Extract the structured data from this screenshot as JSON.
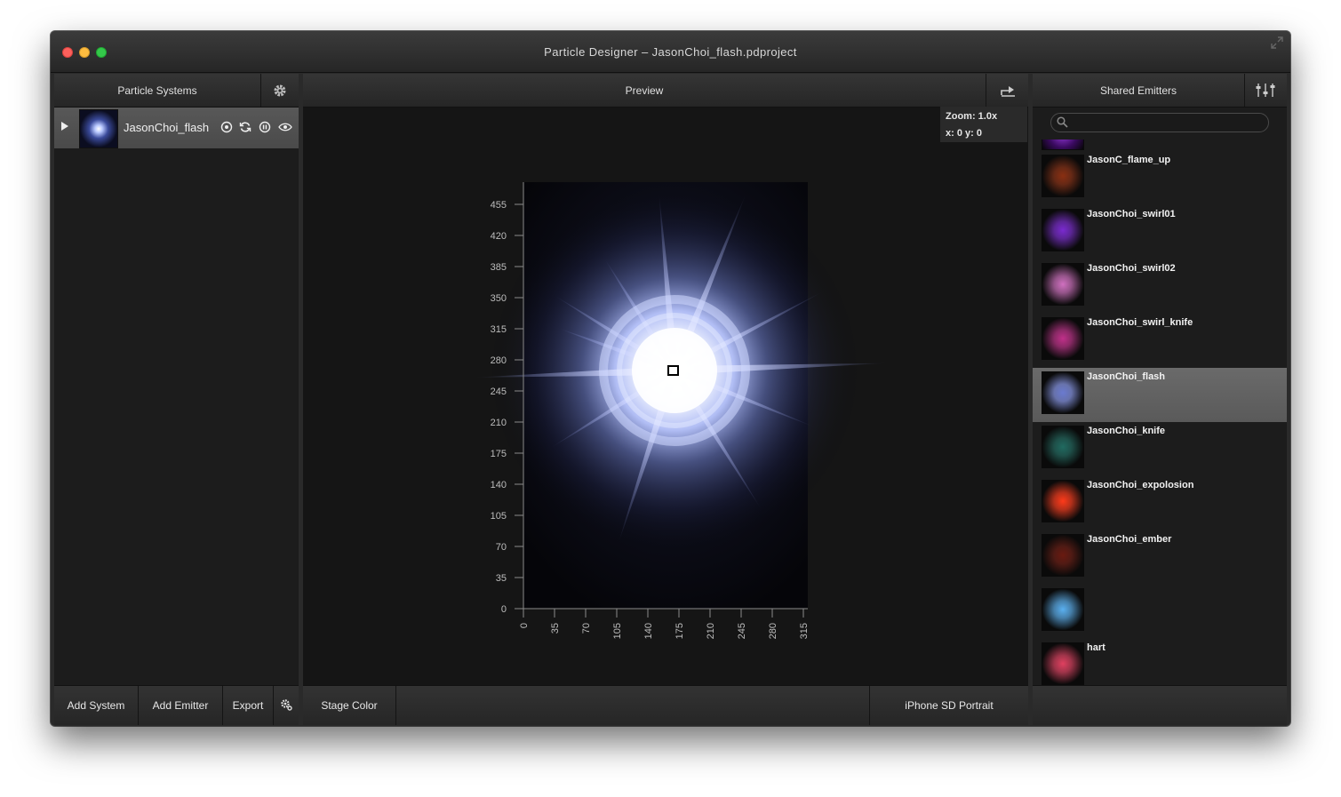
{
  "window": {
    "title": "Particle Designer – JasonChoi_flash.pdproject"
  },
  "left_panel": {
    "header": "Particle Systems",
    "systems": [
      {
        "name": "JasonChoi_flash"
      }
    ],
    "footer": {
      "add_system": "Add System",
      "add_emitter": "Add Emitter",
      "export": "Export"
    }
  },
  "center_panel": {
    "header": "Preview",
    "zoom": "Zoom: 1.0x",
    "coords": "x: 0 y: 0",
    "y_ticks": [
      "455",
      "420",
      "385",
      "350",
      "315",
      "280",
      "245",
      "210",
      "175",
      "140",
      "105",
      "70",
      "35",
      "0"
    ],
    "x_ticks": [
      "0",
      "35",
      "70",
      "105",
      "140",
      "175",
      "210",
      "245",
      "280",
      "315"
    ],
    "footer": {
      "stage_color": "Stage Color",
      "device": "iPhone SD Portrait"
    }
  },
  "right_panel": {
    "header": "Shared Emitters",
    "search_placeholder": "",
    "emitters": [
      {
        "name": "JasonC_flame_up",
        "color": "#8a2f12"
      },
      {
        "name": "JasonChoi_swirl01",
        "color": "#7a2ad0"
      },
      {
        "name": "JasonChoi_swirl02",
        "color": "#d070c0"
      },
      {
        "name": "JasonChoi_swirl_knife",
        "color": "#c0308a"
      },
      {
        "name": "JasonChoi_flash",
        "color": "#6a7ad0",
        "selected": true
      },
      {
        "name": "JasonChoi_knife",
        "color": "#206a60"
      },
      {
        "name": "JasonChoi_expolosion",
        "color": "#ff3a1a"
      },
      {
        "name": "JasonChoi_ember",
        "color": "#6a1a10"
      },
      {
        "name": "",
        "color": "#5ab0f0"
      },
      {
        "name": "hart",
        "color": "#e04060"
      }
    ]
  }
}
